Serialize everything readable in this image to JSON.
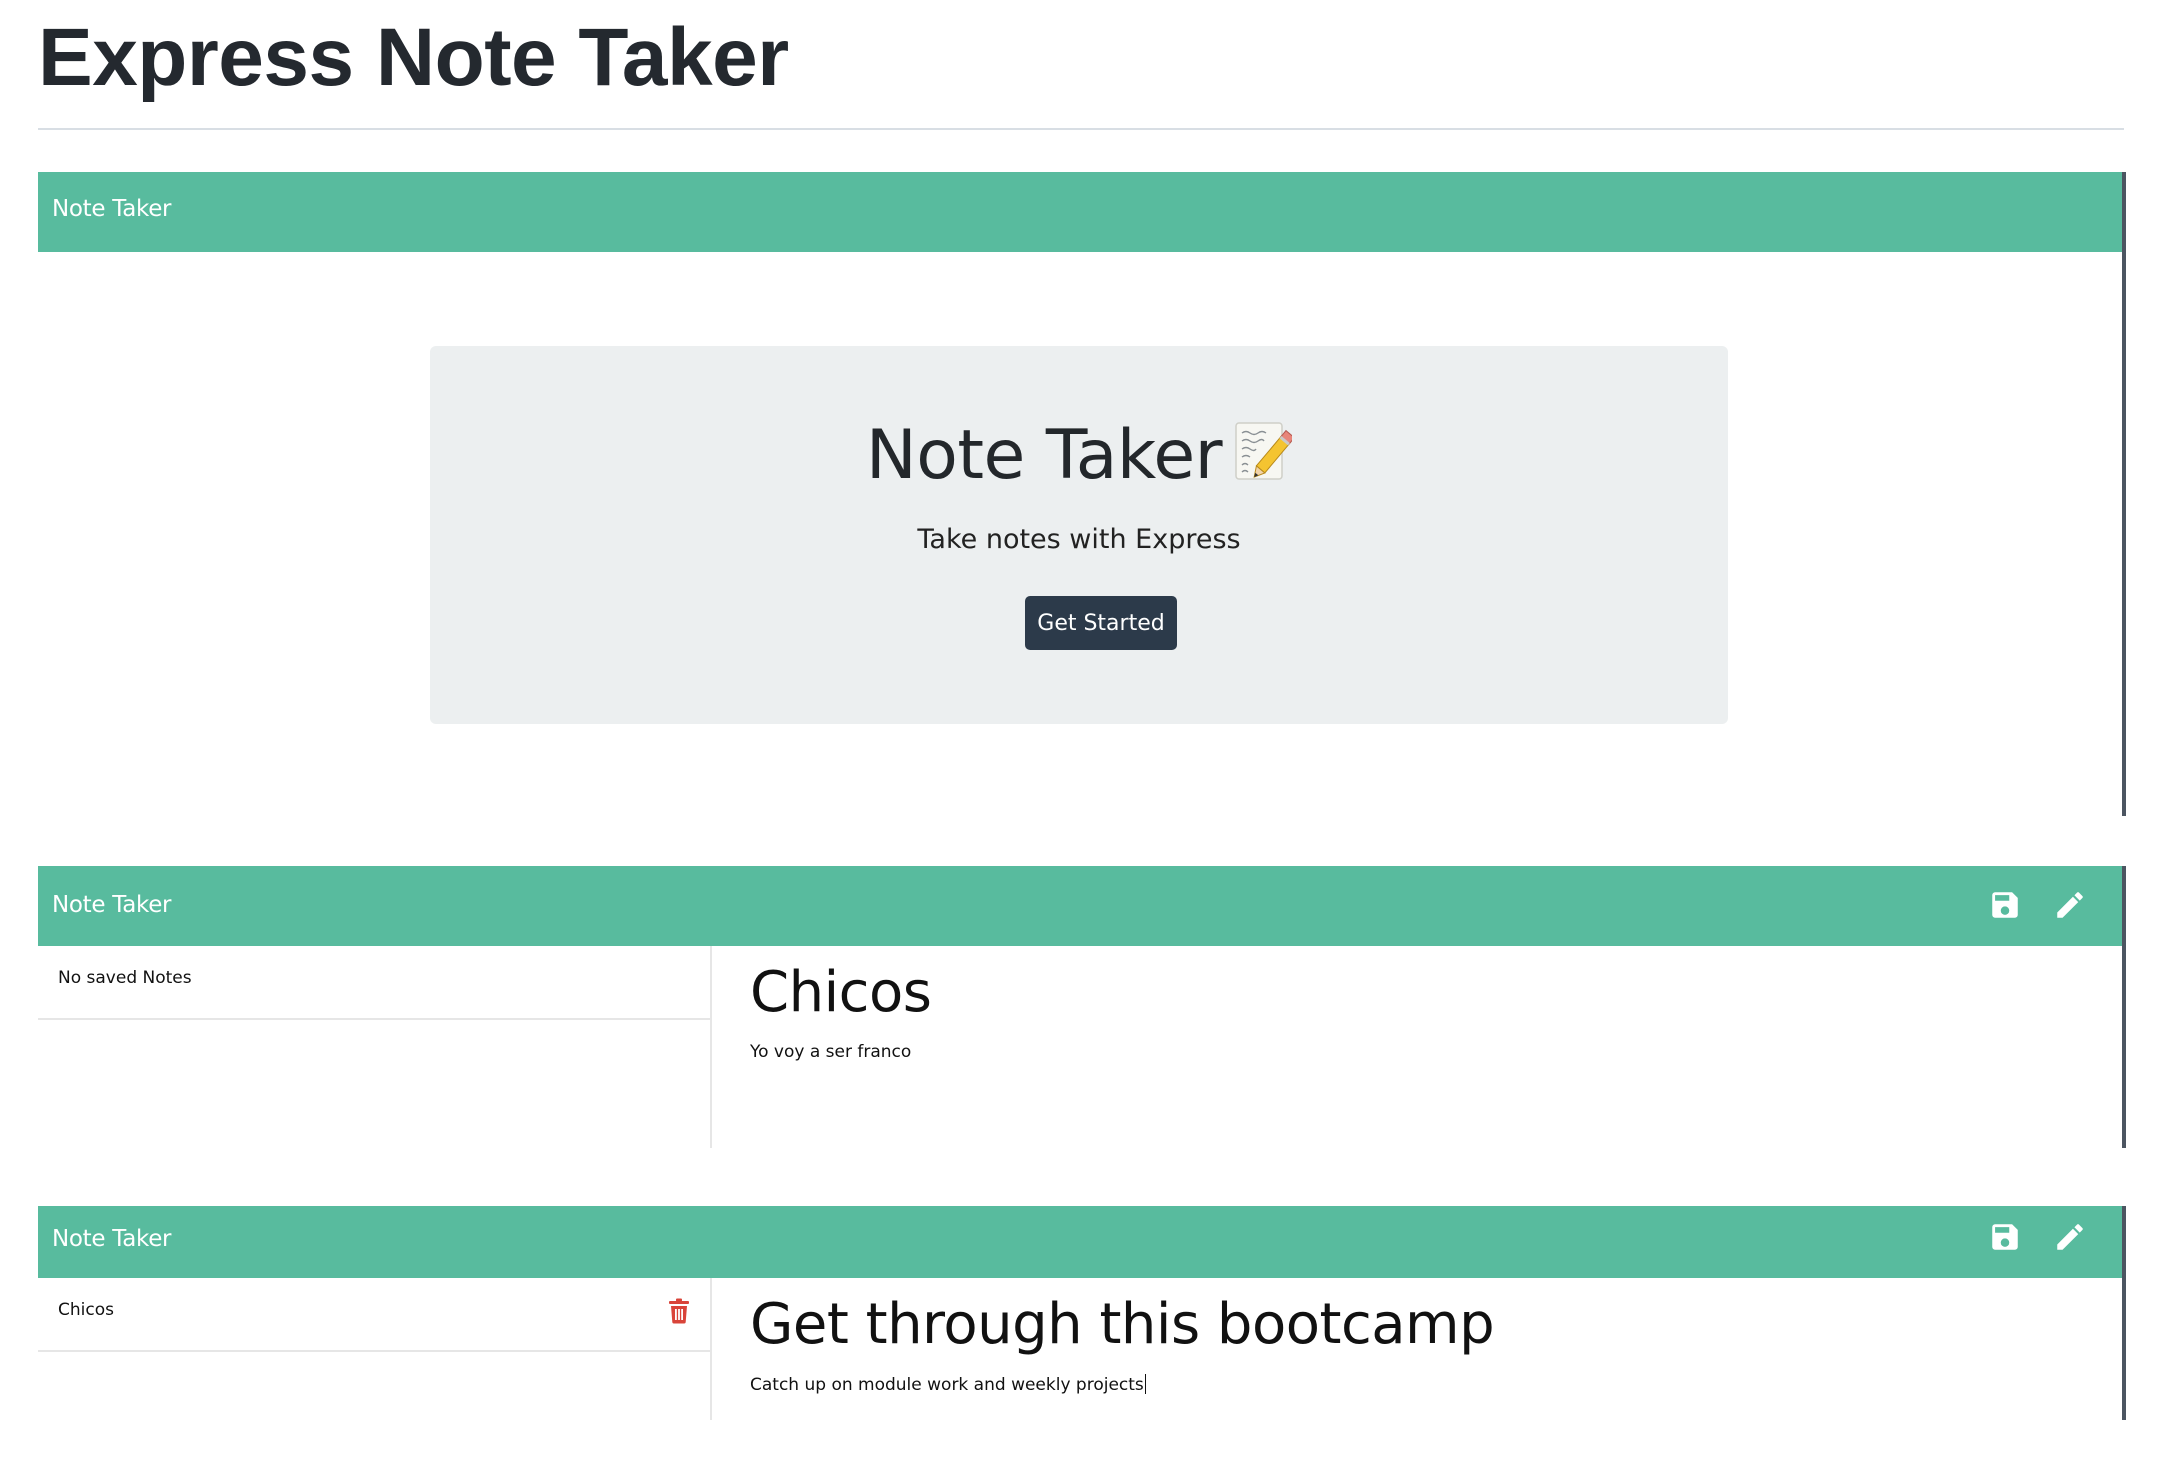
{
  "readme": {
    "title": "Express Note Taker"
  },
  "landing": {
    "navbar": {
      "brand": "Note Taker"
    },
    "jumbotron": {
      "title": "Note Taker",
      "emoji_icon": "memo-pencil-icon",
      "subtitle": "Take notes with Express",
      "button_label": "Get Started"
    }
  },
  "notes_view_1": {
    "navbar": {
      "brand": "Note Taker",
      "icons": [
        "save-icon",
        "pencil-icon"
      ]
    },
    "list": {
      "items": [
        {
          "label": "No saved Notes"
        }
      ]
    },
    "active_note": {
      "title": "Chicos",
      "text": "Yo voy a ser franco"
    }
  },
  "notes_view_2": {
    "navbar": {
      "brand": "Note Taker",
      "icons": [
        "save-icon",
        "pencil-icon"
      ]
    },
    "list": {
      "items": [
        {
          "label": "Chicos",
          "icon": "trash-icon"
        }
      ]
    },
    "active_note": {
      "title": "Get through this bootcamp",
      "text": "Catch up on module work and weekly projects"
    }
  },
  "colors": {
    "navbar_green": "#58bb9e",
    "jumbotron_bg": "#eceff0",
    "button_dark": "#2c3a4a",
    "trash_red": "#d9443a",
    "frame_edge": "#4c5561"
  }
}
